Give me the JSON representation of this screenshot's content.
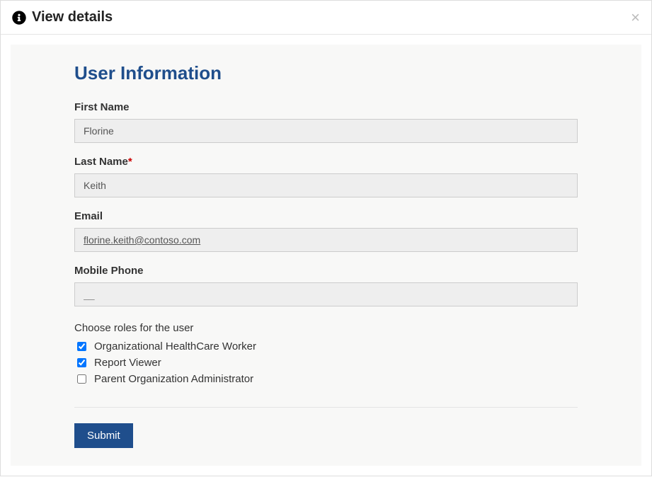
{
  "modal": {
    "title": "View details"
  },
  "form": {
    "section_title": "User Information",
    "first_name": {
      "label": "First Name",
      "value": "Florine"
    },
    "last_name": {
      "label": "Last Name",
      "value": "Keith"
    },
    "email": {
      "label": "Email",
      "value": "florine.keith@contoso.com"
    },
    "mobile_phone": {
      "label": "Mobile Phone",
      "value": "__"
    },
    "roles_label": "Choose roles for the user",
    "roles": [
      {
        "label": "Organizational HealthCare Worker",
        "checked": true
      },
      {
        "label": "Report Viewer",
        "checked": true
      },
      {
        "label": "Parent Organization Administrator",
        "checked": false
      }
    ],
    "submit_label": "Submit"
  }
}
